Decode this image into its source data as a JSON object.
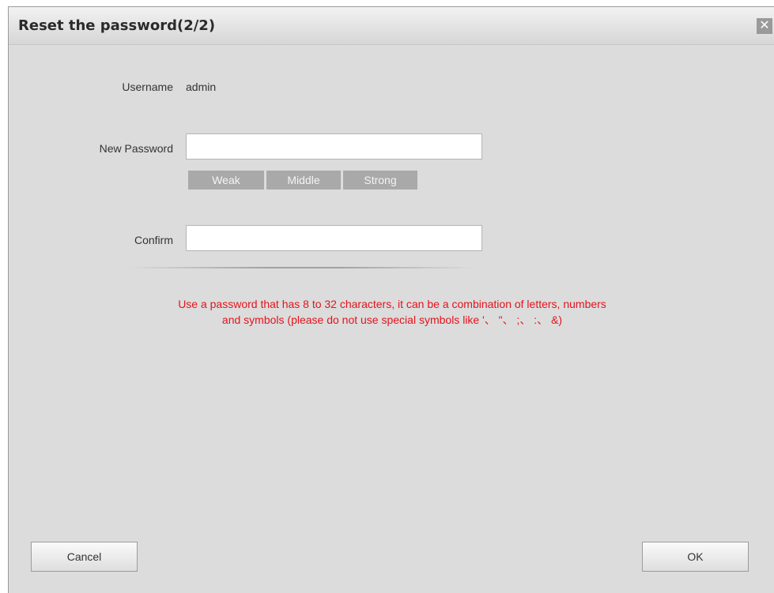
{
  "dialog": {
    "title": "Reset the password(2/2)",
    "close_glyph": "✕"
  },
  "form": {
    "username_label": "Username",
    "username_value": "admin",
    "new_password_label": "New Password",
    "new_password_value": "",
    "confirm_label": "Confirm",
    "confirm_value": ""
  },
  "strength": {
    "levels": [
      "Weak",
      "Middle",
      "Strong"
    ]
  },
  "hint": {
    "line1": "Use a password that has 8 to 32 characters, it can be a combination of letters, numbers",
    "line2": "and symbols (please do not use special symbols like '、 \"、 ;、 :、 &)"
  },
  "buttons": {
    "cancel": "Cancel",
    "ok": "OK"
  },
  "colors": {
    "hint": "#e2141c",
    "dialog_bg": "#dcdcdc",
    "strength_bar": "#a9a9a9"
  },
  "icons": {
    "close": "close-icon"
  }
}
